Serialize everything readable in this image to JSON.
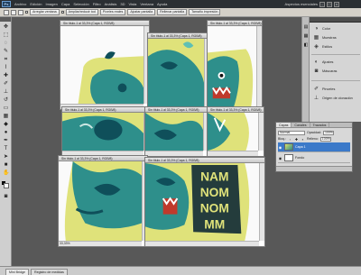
{
  "menubar": {
    "logo": "Ps",
    "items": [
      "Archivo",
      "Edición",
      "Imagen",
      "Capa",
      "Selección",
      "Filtro",
      "Análisis",
      "3D",
      "Vista",
      "Ventana",
      "Ayuda"
    ],
    "workspace": "Aspectos esenciales",
    "minimize": "-",
    "maximize": "□",
    "close": "x"
  },
  "options": {
    "buttons": [
      "Arreglar ventana",
      "Ampliar/reducir tod",
      "Píxeles reales",
      "Ajustar pantalla",
      "Rellenar pantalla",
      "Tamaño impresión"
    ]
  },
  "docs": [
    {
      "title": "Sin título-1 al 33,3% (Capa 1, RGB/8)",
      "zoom": "33,33%"
    },
    {
      "title": "Sin título-1 al 33,3% (Capa 1, RGB/8)",
      "zoom": "33,33%"
    },
    {
      "title": "Sin título-1 al 33,3% (Capa 1, RGB/8)",
      "zoom": "33,33%"
    },
    {
      "title": "Sin título-1 al 33,3% (Capa 1, RGB/8)",
      "zoom": "33,33%"
    },
    {
      "title": "Sin título-1 al 33,3% (Capa 1, RGB/8)",
      "zoom": "33,33%"
    },
    {
      "title": "Sin título-1 al 33,3% (Capa 1, RGB/8)",
      "zoom": "33,33%"
    },
    {
      "title": "Sin título-1 al 33,3% (Capa 1, RGB/8)",
      "zoom": "33,33%"
    },
    {
      "title": "Sin título-1 al 33,3% (Capa 1, RGB/8)",
      "zoom": "33,33%"
    }
  ],
  "art_text": [
    "NAM",
    "NOM",
    "NOM",
    "MM"
  ],
  "dock": {
    "items": [
      "Color",
      "Muestras",
      "Estilos",
      "Ajustes",
      "Máscaras",
      "Pinceles",
      "Origen de clonación"
    ]
  },
  "layers": {
    "tabs": [
      "Capas",
      "Canales",
      "Trazados"
    ],
    "blend": "Normal",
    "opacity_label": "Opacidad:",
    "opacity": "100%",
    "lock_label": "Bloq.:",
    "fill_label": "Relleno:",
    "fill": "100%",
    "rows": [
      "Capa 1",
      "Fondo"
    ]
  },
  "bottom": {
    "tabs": [
      "Mini Bridge",
      "Registro de medidas"
    ]
  },
  "colors": {
    "art_yellow": "#dfe27a",
    "art_teal": "#2e8f8b",
    "art_dark": "#0f4f5a",
    "selection_blue": "#3b79c9"
  }
}
